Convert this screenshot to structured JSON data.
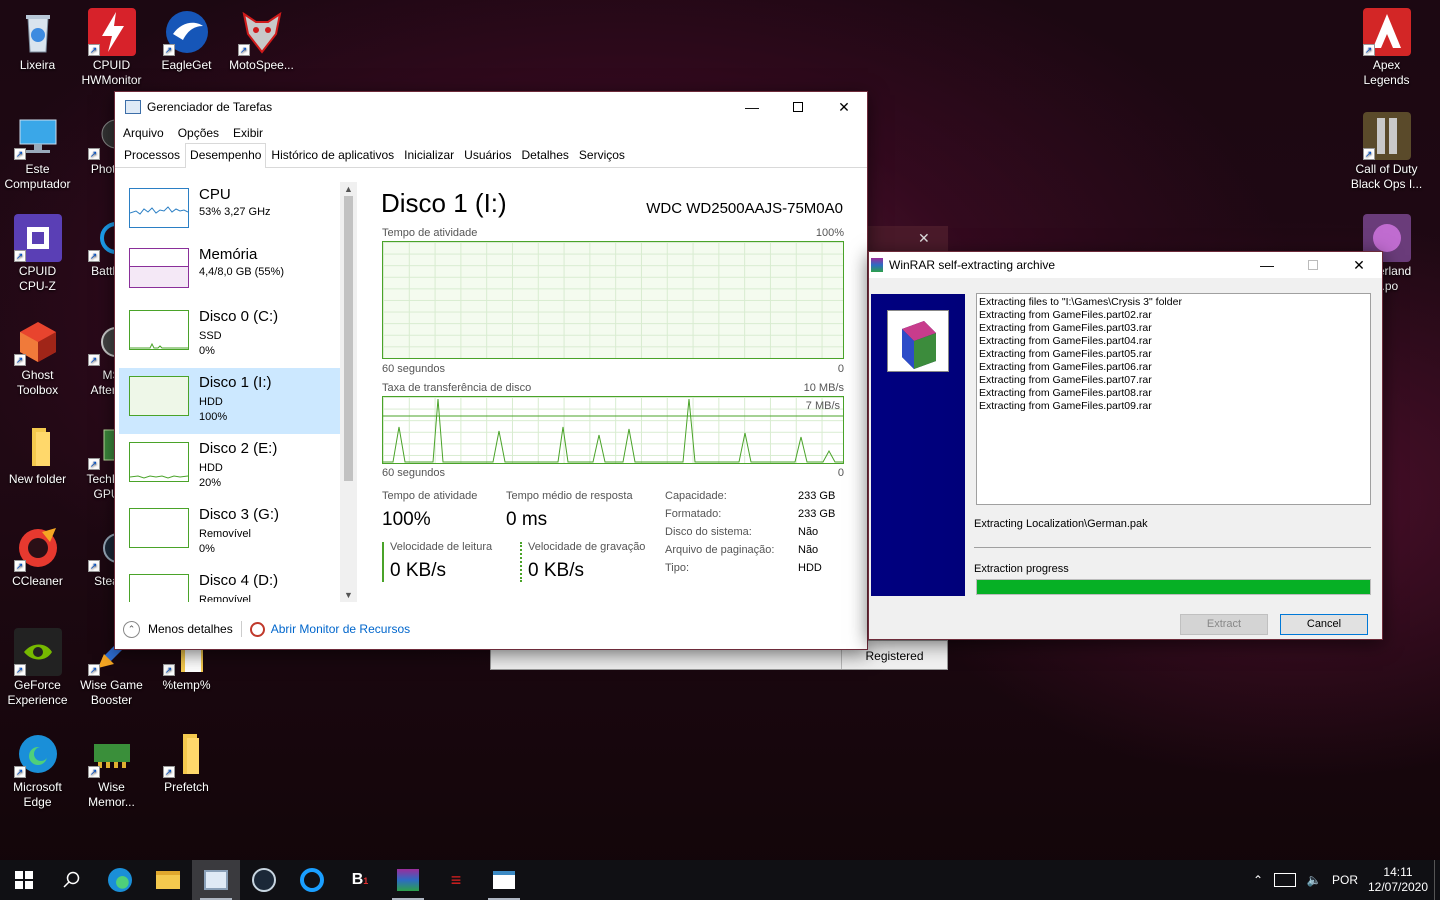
{
  "desktop": {
    "icons": [
      {
        "label": "Lixeira",
        "icon": "recycle-bin-icon"
      },
      {
        "label": "CPUID\nHWMonitor",
        "icon": "hwmonitor-icon"
      },
      {
        "label": "EagleGet",
        "icon": "eagleget-icon"
      },
      {
        "label": "MotoSpee...",
        "icon": "motospeed-icon"
      },
      {
        "label": "Este\nComputador",
        "icon": "computer-icon"
      },
      {
        "label": "Photo...",
        "icon": "photo-icon"
      },
      {
        "label": "CPUID\nCPU-Z",
        "icon": "cpuz-icon"
      },
      {
        "label": "Battle...",
        "icon": "battlenet-icon"
      },
      {
        "label": "Ghost\nToolbox",
        "icon": "ghost-toolbox-icon"
      },
      {
        "label": "MS\nAfterb...",
        "icon": "afterburner-icon"
      },
      {
        "label": "New folder",
        "icon": "folder-icon"
      },
      {
        "label": "TechPo...\nGPU...",
        "icon": "gpuz-icon"
      },
      {
        "label": "CCleaner",
        "icon": "ccleaner-icon"
      },
      {
        "label": "Stea...",
        "icon": "steam-icon"
      },
      {
        "label": "GeForce\nExperience",
        "icon": "geforce-icon"
      },
      {
        "label": "Wise Game\nBooster",
        "icon": "wise-game-booster-icon"
      },
      {
        "label": "%temp%",
        "icon": "folder-icon"
      },
      {
        "label": "Microsoft\nEdge",
        "icon": "edge-icon"
      },
      {
        "label": "Wise\nMemor...",
        "icon": "wise-memory-icon"
      },
      {
        "label": "Prefetch",
        "icon": "folder-icon"
      },
      {
        "label": "Apex\nLegends",
        "icon": "apex-icon"
      },
      {
        "label": "Call of Duty\nBlack Ops I...",
        "icon": "cod-icon"
      },
      {
        "label": "...verland\n...po",
        "icon": "game-icon"
      }
    ]
  },
  "taskmanager": {
    "title": "Gerenciador de Tarefas",
    "menu": [
      "Arquivo",
      "Opções",
      "Exibir"
    ],
    "tabs": [
      "Processos",
      "Desempenho",
      "Histórico de aplicativos",
      "Inicializar",
      "Usuários",
      "Detalhes",
      "Serviços"
    ],
    "sidebar": [
      {
        "name": "CPU",
        "s1": "53% 3,27 GHz",
        "s2": ""
      },
      {
        "name": "Memória",
        "s1": "4,4/8,0 GB (55%)",
        "s2": ""
      },
      {
        "name": "Disco 0 (C:)",
        "s1": "SSD",
        "s2": "0%"
      },
      {
        "name": "Disco 1 (I:)",
        "s1": "HDD",
        "s2": "100%"
      },
      {
        "name": "Disco 2 (E:)",
        "s1": "HDD",
        "s2": "20%"
      },
      {
        "name": "Disco 3 (G:)",
        "s1": "Removível",
        "s2": "0%"
      },
      {
        "name": "Disco 4 (D:)",
        "s1": "Removível",
        "s2": ""
      }
    ],
    "main": {
      "title": "Disco 1 (I:)",
      "model": "WDC WD2500AAJS-75M0A0",
      "graph1_label": "Tempo de atividade",
      "graph1_max": "100%",
      "graph1_left": "60 segundos",
      "graph1_right": "0",
      "graph2_label": "Taxa de transferência de disco",
      "graph2_max": "10 MB/s",
      "graph2_mark": "7 MB/s",
      "graph2_left": "60 segundos",
      "graph2_right": "0",
      "active_time_label": "Tempo de atividade",
      "active_time_value": "100%",
      "avg_response_label": "Tempo médio de resposta",
      "avg_response_value": "0 ms",
      "read_label": "Velocidade de leitura",
      "read_value": "0 KB/s",
      "write_label": "Velocidade de gravação",
      "write_value": "0 KB/s",
      "info": [
        {
          "k": "Capacidade:",
          "v": "233 GB"
        },
        {
          "k": "Formatado:",
          "v": "233 GB"
        },
        {
          "k": "Disco do sistema:",
          "v": "Não"
        },
        {
          "k": "Arquivo de paginação:",
          "v": "Não"
        },
        {
          "k": "Tipo:",
          "v": "HDD"
        }
      ]
    },
    "footer": {
      "less_details": "Menos detalhes",
      "resource_monitor": "Abrir Monitor de Recursos"
    }
  },
  "winrar": {
    "title": "WinRAR self-extracting archive",
    "log": [
      "Extracting files to \"I:\\Games\\Crysis 3\" folder",
      "Extracting from GameFiles.part02.rar",
      "Extracting from GameFiles.part03.rar",
      "Extracting from GameFiles.part04.rar",
      "Extracting from GameFiles.part05.rar",
      "Extracting from GameFiles.part06.rar",
      "Extracting from GameFiles.part07.rar",
      "Extracting from GameFiles.part08.rar",
      "Extracting from GameFiles.part09.rar"
    ],
    "current": "Extracting Localization\\German.pak",
    "progress_label": "Extraction progress",
    "progress": 1.0,
    "extract_button": "Extract",
    "cancel_button": "Cancel"
  },
  "background_window": {
    "status": "Registered"
  },
  "tray": {
    "lang": "POR",
    "time": "14:11",
    "date": "12/07/2020"
  },
  "colors": {
    "disk_green": "#4aa329",
    "progress_green": "#06b025",
    "selection": "#cce8ff"
  }
}
